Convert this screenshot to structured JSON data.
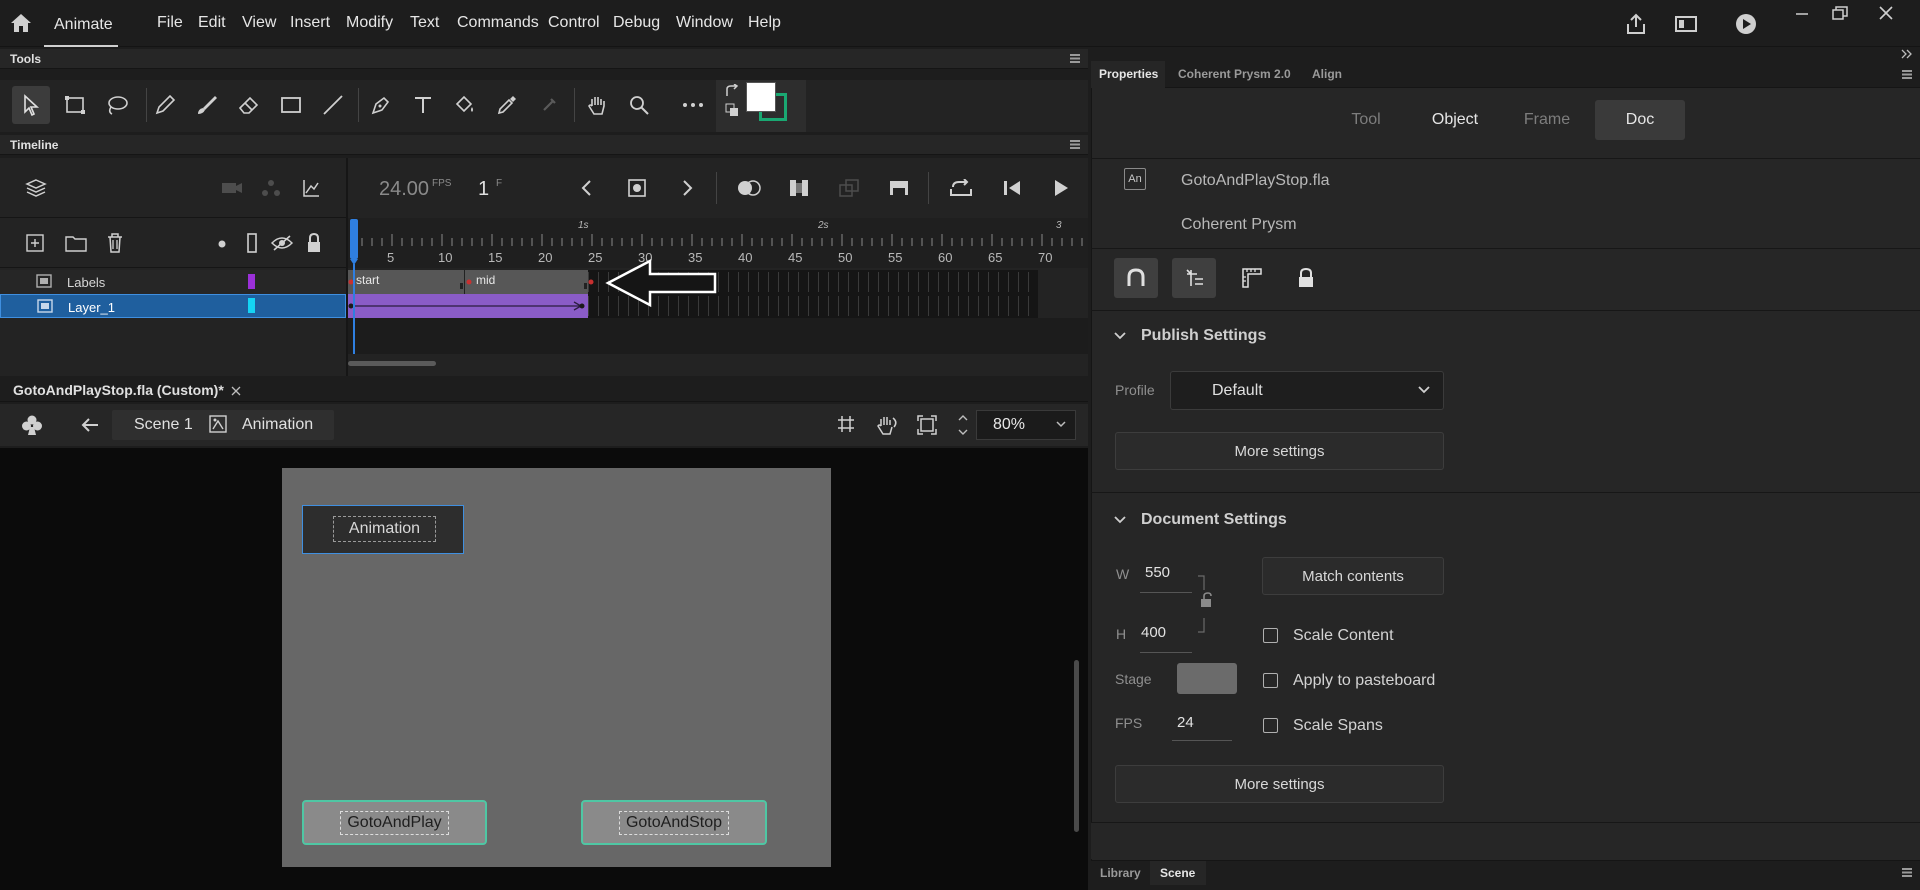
{
  "app": {
    "name": "Animate"
  },
  "menu": [
    "File",
    "Edit",
    "View",
    "Insert",
    "Modify",
    "Text",
    "Commands",
    "Control",
    "Debug",
    "Window",
    "Help"
  ],
  "tools_panel": {
    "title": "Tools"
  },
  "timeline": {
    "title": "Timeline",
    "fps": "24.00",
    "fps_unit": "FPS",
    "frame": "1",
    "frame_unit": "F",
    "ruler_numbers": [
      "5",
      "10",
      "15",
      "20",
      "25",
      "30",
      "35",
      "40",
      "45",
      "50",
      "55",
      "60",
      "65",
      "70"
    ],
    "time_marks": [
      "1s",
      "2s",
      "3"
    ],
    "layers": [
      {
        "name": "Labels",
        "color": "#9b30d9"
      },
      {
        "name": "Layer_1",
        "color": "#14d4f4"
      }
    ],
    "frame_labels": [
      "start",
      "mid"
    ]
  },
  "document": {
    "tab_title": "GotoAndPlayStop.fla (Custom)*",
    "scene": "Scene 1",
    "symbol": "Animation",
    "zoom": "80%"
  },
  "stage": {
    "animation_label": "Animation",
    "goto_play_label": "GotoAndPlay",
    "goto_stop_label": "GotoAndStop"
  },
  "properties": {
    "tabs": [
      "Properties",
      "Coherent Prysm 2.0",
      "Align"
    ],
    "segments": [
      "Tool",
      "Object",
      "Frame",
      "Doc"
    ],
    "active_segment": "Doc",
    "file_name": "GotoAndPlayStop.fla",
    "target": "Coherent Prysm",
    "file_badge": "An",
    "publish": {
      "title": "Publish Settings",
      "profile_label": "Profile",
      "profile_value": "Default",
      "more_settings": "More settings"
    },
    "doc_settings": {
      "title": "Document Settings",
      "w_label": "W",
      "w_value": "550",
      "h_label": "H",
      "h_value": "400",
      "match_contents": "Match contents",
      "scale_content": "Scale Content",
      "stage_label": "Stage",
      "apply_pasteboard": "Apply to pasteboard",
      "fps_label": "FPS",
      "fps_value": "24",
      "scale_spans": "Scale Spans",
      "more_settings": "More settings",
      "stage_color": "#6b6b6b"
    },
    "bottom_tabs": [
      "Library",
      "Scene"
    ]
  },
  "colors": {
    "accent_green": "#4fc7a4",
    "selection_blue": "#1f5f9e",
    "tween_purple": "#8a5cc7",
    "playhead_blue": "#2f7fe0"
  }
}
